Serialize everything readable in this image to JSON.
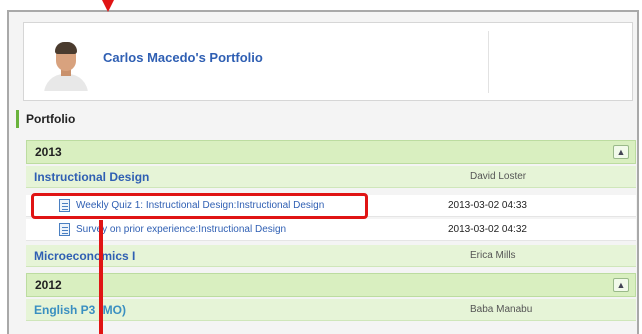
{
  "header": {
    "owner_title": "Carlos Macedo's Portfolio"
  },
  "section": {
    "heading": "Portfolio"
  },
  "years": [
    {
      "year": "2013",
      "courses": [
        {
          "title": "Instructional Design",
          "teacher": "David Loster",
          "activities": [
            {
              "title": "Weekly Quiz 1: Instructional Design:Instructional Design",
              "date": "2013-03-02 04:33",
              "icon": "quiz-icon"
            },
            {
              "title": "Survey on prior experience:Instructional Design",
              "date": "2013-03-02 04:32",
              "icon": "survey-icon"
            }
          ]
        },
        {
          "title": "Microeconomics I",
          "teacher": "Erica Mills",
          "activities": []
        }
      ]
    },
    {
      "year": "2012",
      "courses": [
        {
          "title": "English P3 (MO)",
          "teacher": "Baba Manabu",
          "activities": []
        }
      ]
    }
  ],
  "collapse_icon": "collapse-arrows-icon",
  "colors": {
    "accent": "#6ab33c",
    "link": "#2f5fb3",
    "year_bar": "#d9efc0",
    "course_row": "#e6f4d7",
    "highlight": "#e01414"
  }
}
